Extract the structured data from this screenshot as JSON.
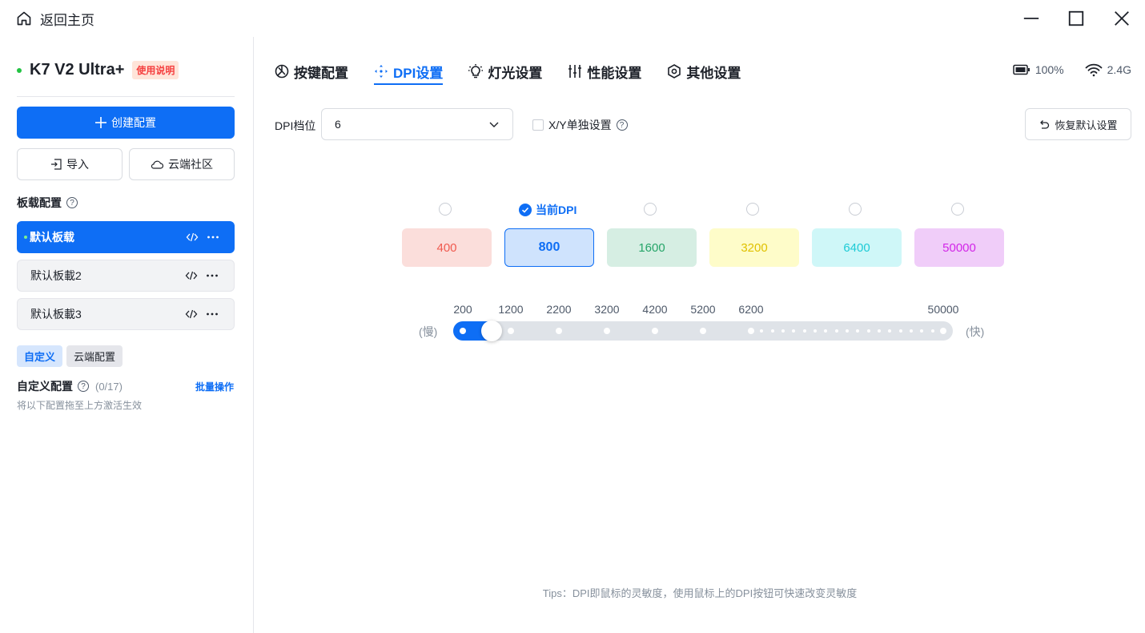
{
  "titlebar": {
    "home_label": "返回主页"
  },
  "sidebar": {
    "device_name": "K7 V2 Ultra+",
    "manual_badge": "使用说明",
    "create_label": "创建配置",
    "import_label": "导入",
    "cloud_label": "云端社区",
    "onboard_title": "板载配置",
    "profiles": [
      {
        "name": "默认板载",
        "active": true
      },
      {
        "name": "默认板載2",
        "active": false
      },
      {
        "name": "默认板載3",
        "active": false
      }
    ],
    "tags": [
      "自定义",
      "云端配置"
    ],
    "custom_title": "自定义配置",
    "custom_count": "(0/17)",
    "batch_label": "批量操作",
    "hint": "将以下配置拖至上方激活生效"
  },
  "tabs": [
    {
      "label": "按键配置",
      "icon": "pie-icon"
    },
    {
      "label": "DPI设置",
      "icon": "move-arrows-icon"
    },
    {
      "label": "灯光设置",
      "icon": "bulb-icon"
    },
    {
      "label": "性能设置",
      "icon": "sliders-icon"
    },
    {
      "label": "其他设置",
      "icon": "hex-gear-icon"
    }
  ],
  "active_tab": 1,
  "status": {
    "battery": "100%",
    "wireless": "2.4G"
  },
  "dpi": {
    "level_label": "DPI档位",
    "level_value": "6",
    "xy_label": "X/Y单独设置",
    "reset_label": "恢复默认设置",
    "current_label": "当前DPI",
    "current_index": 1,
    "cards": [
      {
        "value": "400",
        "bg": "#fbdedb",
        "fg": "#f05a4f"
      },
      {
        "value": "800",
        "bg": "#cfe3fd",
        "fg": "#0e6ef5"
      },
      {
        "value": "1600",
        "bg": "#d6eee3",
        "fg": "#26a569"
      },
      {
        "value": "3200",
        "bg": "#fefcc9",
        "fg": "#e0c100"
      },
      {
        "value": "6400",
        "bg": "#cff7f8",
        "fg": "#1ecbd6"
      },
      {
        "value": "50000",
        "bg": "#f0cdf9",
        "fg": "#d226e8"
      }
    ],
    "slider": {
      "ticks": [
        "200",
        "1200",
        "2200",
        "3200",
        "4200",
        "5200",
        "6200",
        "50000"
      ],
      "value": 800,
      "slow_label": "(慢)",
      "fast_label": "(快)"
    }
  },
  "tips": "Tips：DPI即鼠标的灵敏度，使用鼠标上的DPI按钮可快速改变灵敏度"
}
